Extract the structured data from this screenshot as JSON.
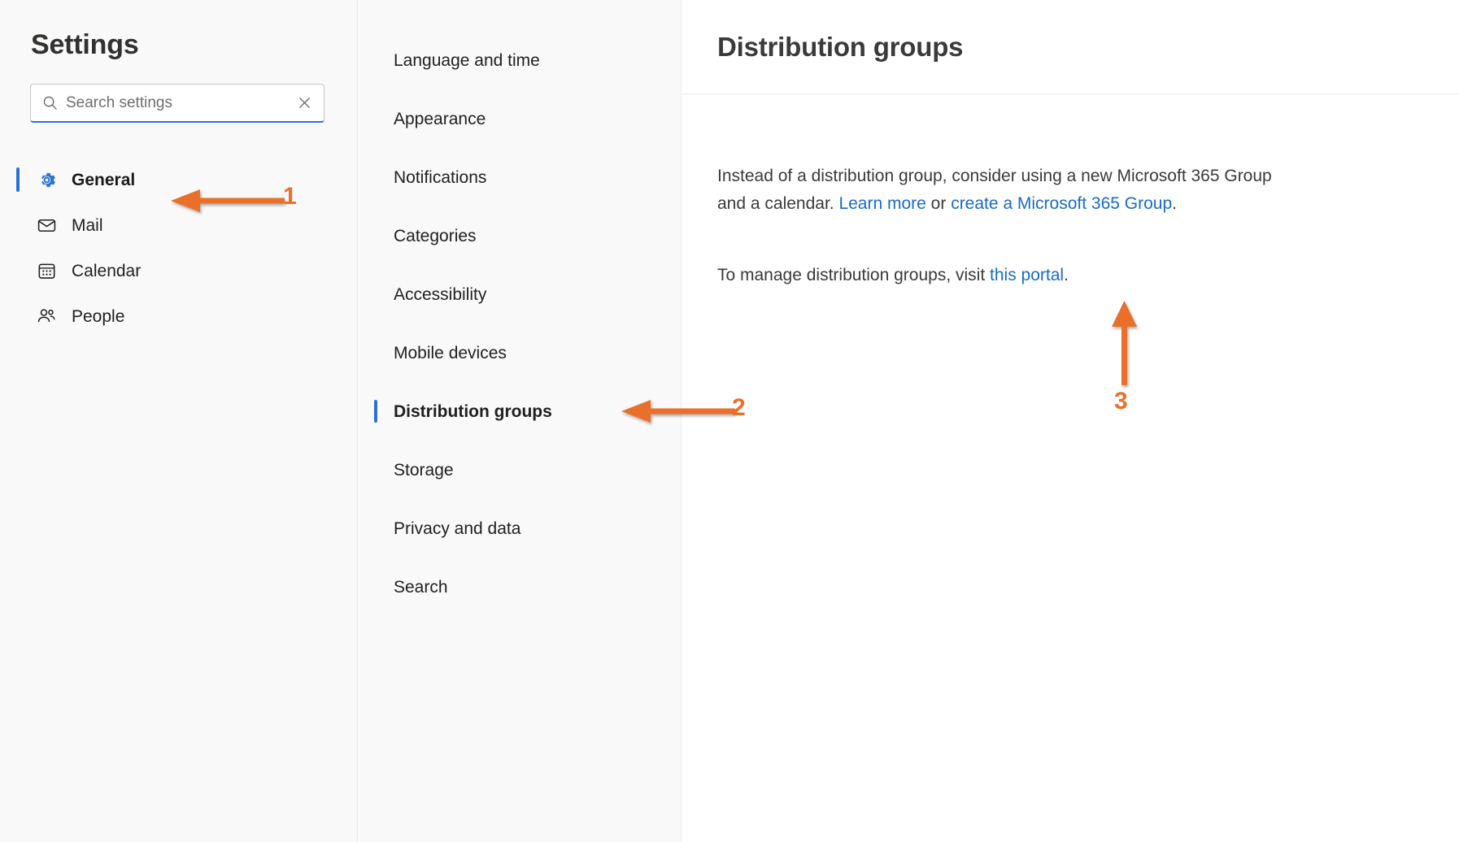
{
  "sidebar": {
    "title": "Settings",
    "search": {
      "placeholder": "Search settings",
      "value": "",
      "search_icon": "search-icon",
      "clear_icon": "close-icon"
    },
    "items": [
      {
        "label": "General",
        "icon": "gear-icon",
        "selected": true
      },
      {
        "label": "Mail",
        "icon": "envelope-icon",
        "selected": false
      },
      {
        "label": "Calendar",
        "icon": "calendar-icon",
        "selected": false
      },
      {
        "label": "People",
        "icon": "people-icon",
        "selected": false
      }
    ]
  },
  "subnav": {
    "items": [
      {
        "label": "Language and time",
        "selected": false
      },
      {
        "label": "Appearance",
        "selected": false
      },
      {
        "label": "Notifications",
        "selected": false
      },
      {
        "label": "Categories",
        "selected": false
      },
      {
        "label": "Accessibility",
        "selected": false
      },
      {
        "label": "Mobile devices",
        "selected": false
      },
      {
        "label": "Distribution groups",
        "selected": true
      },
      {
        "label": "Storage",
        "selected": false
      },
      {
        "label": "Privacy and data",
        "selected": false
      },
      {
        "label": "Search",
        "selected": false
      }
    ]
  },
  "main": {
    "title": "Distribution groups",
    "paragraph1": {
      "text_before": "Instead of a distribution group, consider using a new Microsoft 365 Group",
      "text_line2_before": "and a calendar. ",
      "link1": "Learn more",
      "between": " or ",
      "link2": "create a Microsoft 365 Group",
      "text_after": "."
    },
    "paragraph2": {
      "text_before": "To manage distribution groups, visit ",
      "link": "this portal",
      "text_after": "."
    }
  },
  "annotations": {
    "color": "#e8702a",
    "markers": [
      {
        "number": "1",
        "direction": "left",
        "target": "sidebar-item-general"
      },
      {
        "number": "2",
        "direction": "left",
        "target": "subnav-item-distribution-groups"
      },
      {
        "number": "3",
        "direction": "up",
        "target": "this-portal-link"
      }
    ]
  }
}
